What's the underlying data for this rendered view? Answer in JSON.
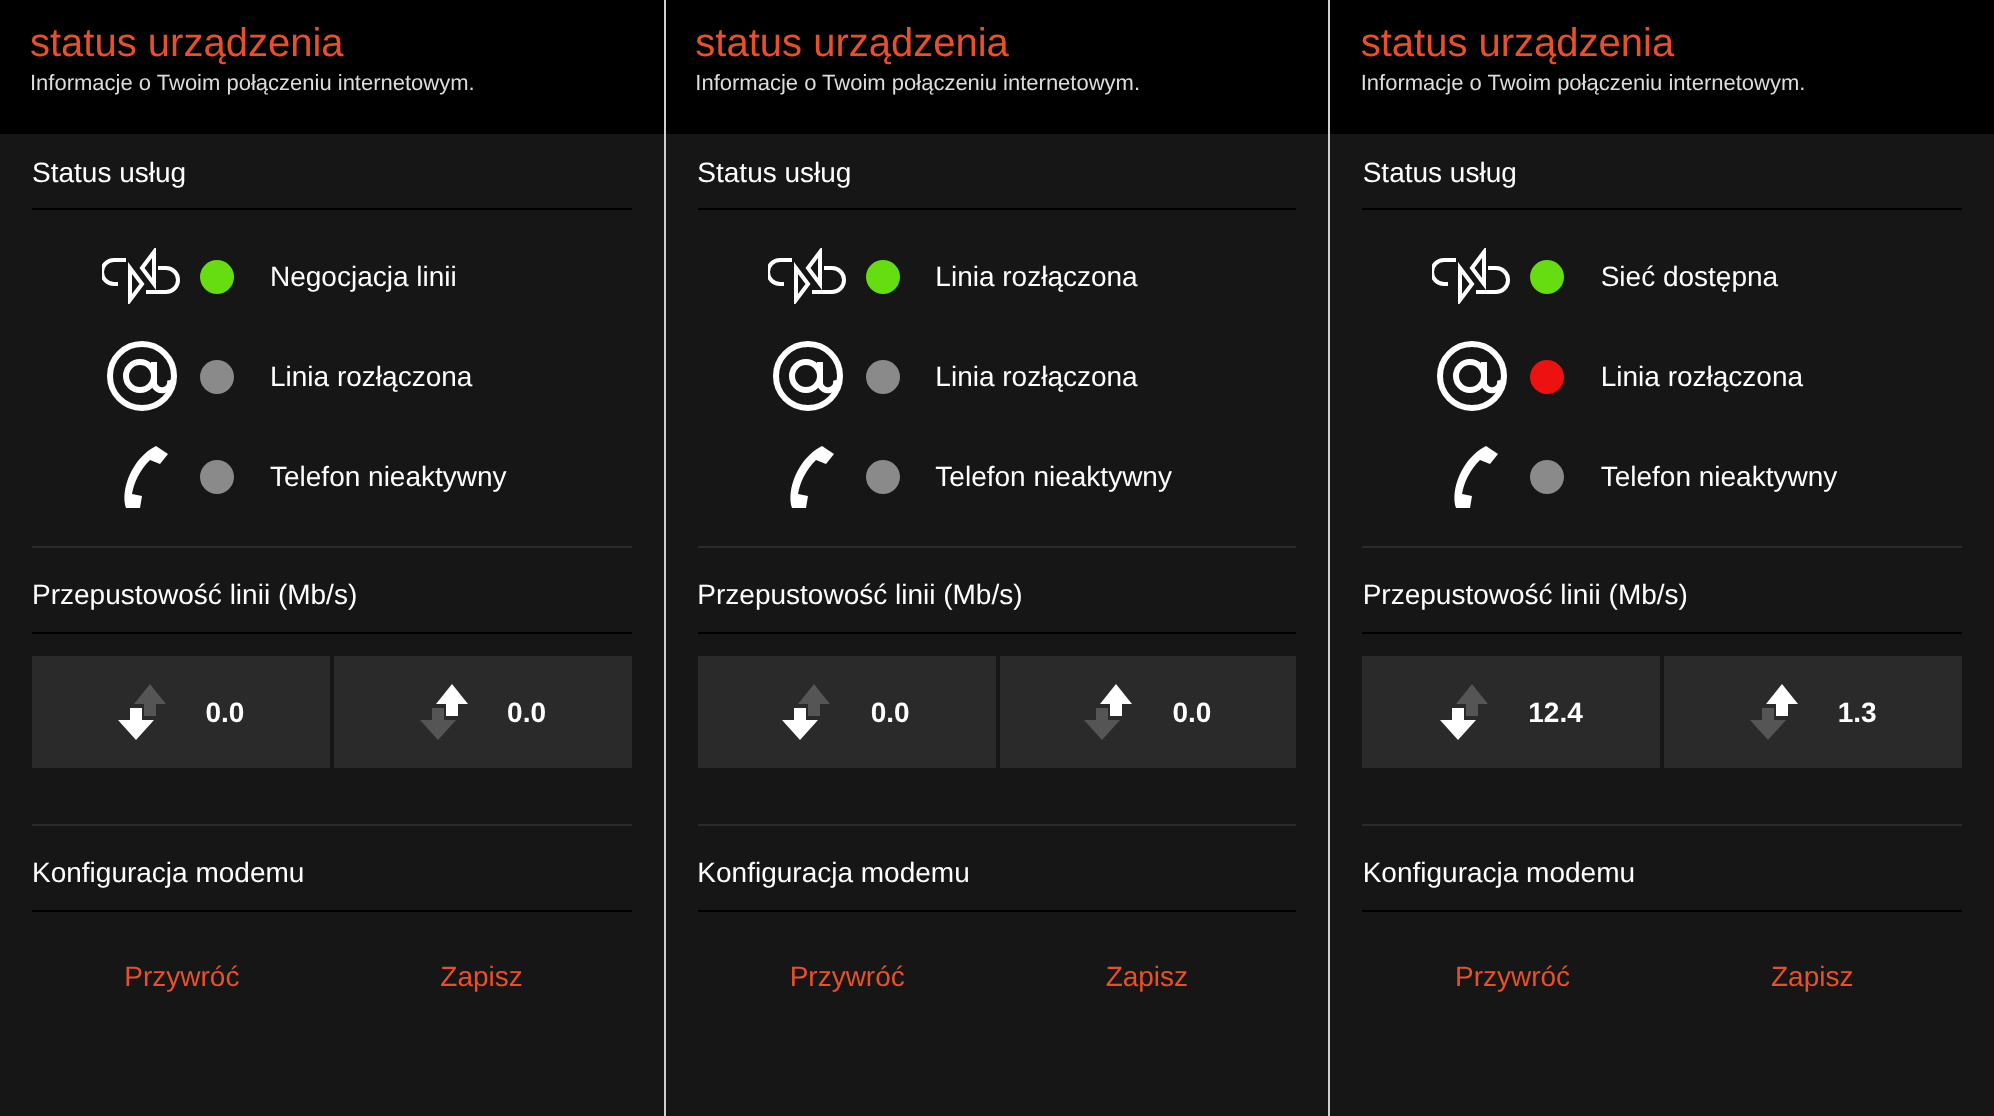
{
  "panels": [
    {
      "title": "status urządzenia",
      "subtitle": "Informacje o Twoim połączeniu internetowym.",
      "services_heading": "Status usług",
      "services": [
        {
          "kind": "sync",
          "color": "#66dd11",
          "label": "Negocjacja linii"
        },
        {
          "kind": "at",
          "color": "#8a8a8a",
          "label": "Linia rozłączona"
        },
        {
          "kind": "phone",
          "color": "#8a8a8a",
          "label": "Telefon nieaktywny"
        }
      ],
      "throughput_heading": "Przepustowość linii (Mb/s)",
      "throughput": [
        {
          "kind": "download",
          "value": "0.0"
        },
        {
          "kind": "upload",
          "value": "0.0"
        }
      ],
      "config_heading": "Konfiguracja modemu",
      "buttons": [
        "Przywróć",
        "Zapisz"
      ]
    },
    {
      "title": "status urządzenia",
      "subtitle": "Informacje o Twoim połączeniu internetowym.",
      "services_heading": "Status usług",
      "services": [
        {
          "kind": "sync",
          "color": "#66dd11",
          "label": "Linia rozłączona"
        },
        {
          "kind": "at",
          "color": "#8a8a8a",
          "label": "Linia rozłączona"
        },
        {
          "kind": "phone",
          "color": "#8a8a8a",
          "label": "Telefon nieaktywny"
        }
      ],
      "throughput_heading": "Przepustowość linii (Mb/s)",
      "throughput": [
        {
          "kind": "download",
          "value": "0.0"
        },
        {
          "kind": "upload",
          "value": "0.0"
        }
      ],
      "config_heading": "Konfiguracja modemu",
      "buttons": [
        "Przywróć",
        "Zapisz"
      ]
    },
    {
      "title": "status urządzenia",
      "subtitle": "Informacje o Twoim połączeniu internetowym.",
      "services_heading": "Status usług",
      "services": [
        {
          "kind": "sync",
          "color": "#66dd11",
          "label": "Sieć dostępna"
        },
        {
          "kind": "at",
          "color": "#ee1111",
          "label": "Linia rozłączona"
        },
        {
          "kind": "phone",
          "color": "#8a8a8a",
          "label": "Telefon nieaktywny"
        }
      ],
      "throughput_heading": "Przepustowość linii (Mb/s)",
      "throughput": [
        {
          "kind": "download",
          "value": "12.4"
        },
        {
          "kind": "upload",
          "value": "1.3"
        }
      ],
      "config_heading": "Konfiguracja modemu",
      "buttons": [
        "Przywróć",
        "Zapisz"
      ]
    }
  ]
}
